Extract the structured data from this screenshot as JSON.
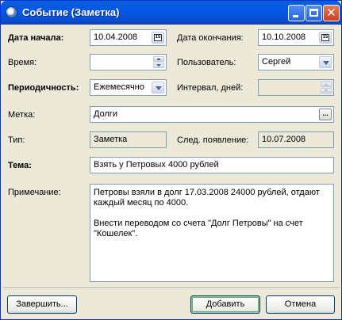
{
  "window": {
    "title": "Событие (Заметка)",
    "icon": "app-disc-icon",
    "controls": {
      "minimize": "minimize-icon",
      "maximize": "maximize-icon",
      "close": "close-icon",
      "close_glyph": "✕"
    }
  },
  "form": {
    "start_date": {
      "label": "Дата начала:",
      "value": "10.04.2008",
      "button_icon": "calendar-icon",
      "button_glyph": "15"
    },
    "end_date": {
      "label": "Дата окончания:",
      "value": "10.10.2008",
      "button_icon": "calendar-icon",
      "button_glyph": "15"
    },
    "time": {
      "label": "Время:",
      "value": ""
    },
    "user": {
      "label": "Пользователь:",
      "value": "Сергей"
    },
    "periodicity": {
      "label": "Периодичность:",
      "value": "Ежемесячно"
    },
    "interval": {
      "label": "Интервал, дней:",
      "value": ""
    },
    "tag": {
      "label": "Метка:",
      "value": "Долги",
      "button_glyph": "..."
    },
    "type": {
      "label": "Тип:",
      "value": "Заметка"
    },
    "next": {
      "label": "След. появление:",
      "value": "10.07.2008"
    },
    "subject": {
      "label": "Тема:",
      "value": "Взять у Петровых 4000 рублей"
    },
    "note": {
      "label": "Примечание:",
      "value": "Петровы взяли в долг 17.03.2008 24000 рублей, отдают\nкаждый месяц по 4000.\n\nВнести переводом со счета \"Долг Петровы\" на счет\n\"Кошелек\"."
    }
  },
  "buttons": {
    "finish": "Завершить...",
    "add": "Добавить",
    "cancel": "Отмена"
  },
  "colors": {
    "titlebar": "#0058e6",
    "dialog_bg": "#ece9d8",
    "field_border": "#7f9db9"
  }
}
